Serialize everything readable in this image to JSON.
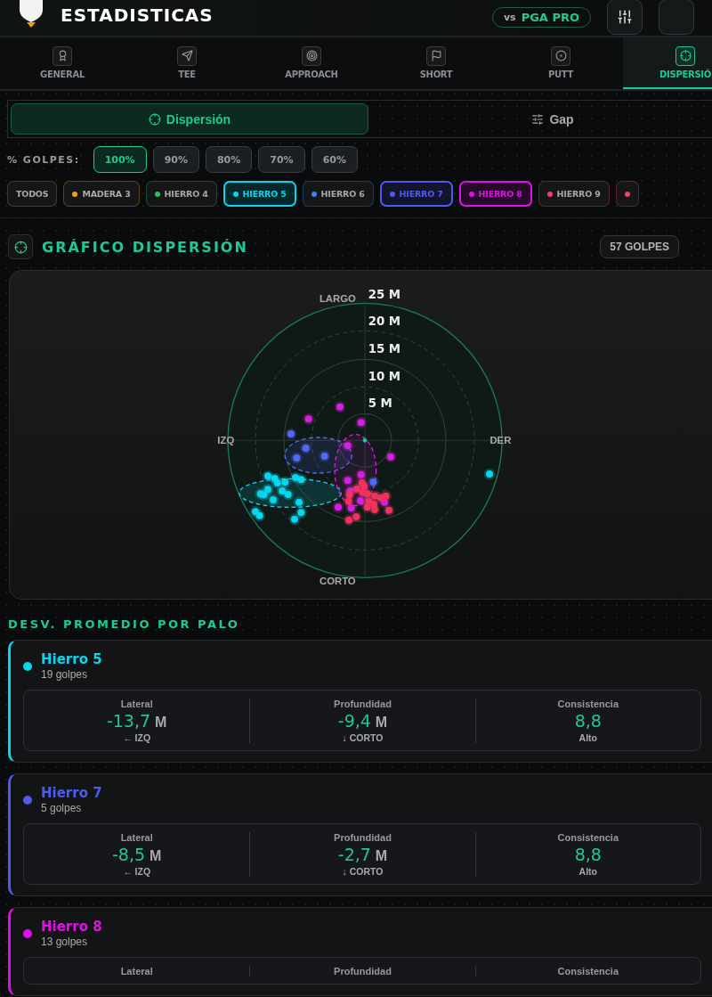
{
  "header": {
    "title": "ESTADISTICAS",
    "compare": {
      "prefix": "vs",
      "label": "PGA PRO"
    }
  },
  "tabs": [
    {
      "label": "GENERAL",
      "selected": false
    },
    {
      "label": "TEE",
      "selected": false
    },
    {
      "label": "APPROACH",
      "selected": false
    },
    {
      "label": "SHORT",
      "selected": false
    },
    {
      "label": "PUTT",
      "selected": false
    },
    {
      "label": "DISPERSIÓ",
      "selected": true
    }
  ],
  "views": [
    {
      "label": "Dispersión",
      "selected": true
    },
    {
      "label": "Gap",
      "selected": false
    }
  ],
  "percent_filter": {
    "label": "% GOLPES:",
    "options": [
      {
        "label": "100%",
        "selected": true
      },
      {
        "label": "90%",
        "selected": false
      },
      {
        "label": "80%",
        "selected": false
      },
      {
        "label": "70%",
        "selected": false
      },
      {
        "label": "60%",
        "selected": false
      }
    ]
  },
  "clubs": [
    {
      "label": "TODOS",
      "selected": false
    },
    {
      "label": "MADERA 3",
      "selected": false,
      "color": "#f59e0b"
    },
    {
      "label": "HIERRO 4",
      "selected": false,
      "color": "#22c55e"
    },
    {
      "label": "HIERRO 5",
      "selected": true,
      "color": "#06d6f0"
    },
    {
      "label": "HIERRO 6",
      "selected": false,
      "color": "#3b82f6"
    },
    {
      "label": "HIERRO 7",
      "selected": true,
      "color": "#4f5bf0"
    },
    {
      "label": "HIERRO 8",
      "selected": true,
      "color": "#e010e8"
    },
    {
      "label": "HIERRO 9",
      "selected": false,
      "color": "#f43f6e"
    },
    {
      "selected": false,
      "color": "#f43f5e"
    }
  ],
  "chart": {
    "title": "GRÁFICO DISPERSIÓN",
    "count": "57 GOLPES",
    "top": "LARGO",
    "bottom": "CORTO",
    "left": "IZQ",
    "right": "DER",
    "rings": [
      "25 M",
      "20 M",
      "15 M",
      "10 M",
      "5 M"
    ]
  },
  "summary": {
    "title": "DESV. PROMEDIO POR PALO",
    "cards": [
      {
        "name": "Hierro 5",
        "shots": "19 golpes",
        "color": "#06d6f0",
        "stats": [
          {
            "label": "Lateral",
            "value": "-13,7",
            "unit": "M",
            "note": "← IZQ"
          },
          {
            "label": "Profundidad",
            "value": "-9,4",
            "unit": "M",
            "note": "↓ CORTO"
          },
          {
            "label": "Consistencia",
            "value": "8,8",
            "note": "Alto"
          }
        ]
      },
      {
        "name": "Hierro 7",
        "shots": "5 golpes",
        "color": "#4f5bf0",
        "stats": [
          {
            "label": "Lateral",
            "value": "-8,5",
            "unit": "M",
            "note": "← IZQ"
          },
          {
            "label": "Profundidad",
            "value": "-2,7",
            "unit": "M",
            "note": "↓ CORTO"
          },
          {
            "label": "Consistencia",
            "value": "8,8",
            "note": "Alto"
          }
        ]
      },
      {
        "name": "Hierro 8",
        "shots": "13 golpes",
        "color": "#e010e8",
        "stats": [
          {
            "label": "Lateral"
          },
          {
            "label": "Profundidad"
          },
          {
            "label": "Consistencia"
          }
        ]
      }
    ]
  }
}
